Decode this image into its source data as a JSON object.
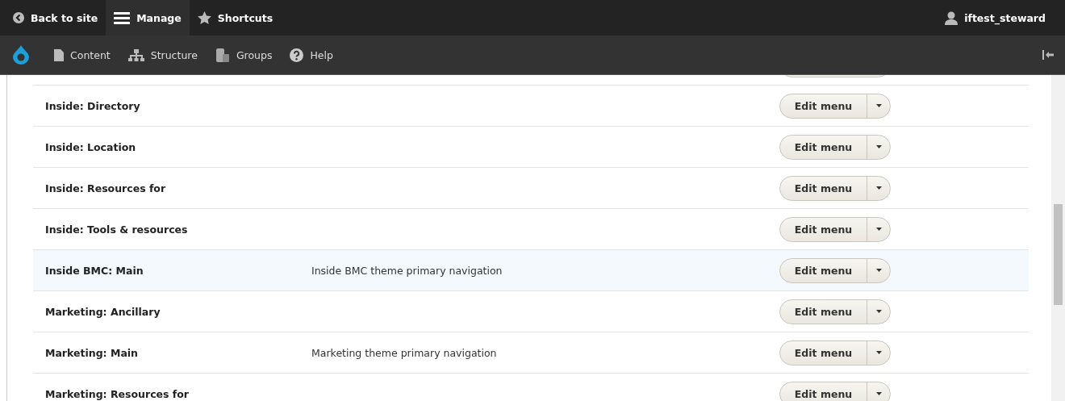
{
  "toolbar": {
    "tabs": [
      {
        "label": "Back to site",
        "selected": false
      },
      {
        "label": "Manage",
        "selected": true
      },
      {
        "label": "Shortcuts",
        "selected": false
      }
    ],
    "user": "iftest_steward"
  },
  "tray": {
    "items": [
      {
        "label": "Content"
      },
      {
        "label": "Structure"
      },
      {
        "label": "Groups"
      },
      {
        "label": "Help"
      }
    ]
  },
  "menus": [
    {
      "title": "Inside: Directory",
      "selected": false,
      "button": "Edit menu"
    },
    {
      "title": "Inside: Location",
      "selected": false,
      "button": "Edit menu"
    },
    {
      "title": "Inside: Resources for",
      "selected": false,
      "button": "Edit menu"
    },
    {
      "title": "Inside: Tools & resources",
      "selected": false,
      "button": "Edit menu"
    },
    {
      "title": "Inside BMC: Main",
      "description": "Inside BMC theme primary navigation",
      "selected": true,
      "button": "Edit menu"
    },
    {
      "title": "Marketing: Ancillary",
      "selected": false,
      "button": "Edit menu"
    },
    {
      "title": "Marketing: Main",
      "description": "Marketing theme primary navigation",
      "selected": false,
      "button": "Edit menu"
    },
    {
      "title": "Marketing: Resources for",
      "selected": false,
      "button": "Edit menu"
    }
  ]
}
